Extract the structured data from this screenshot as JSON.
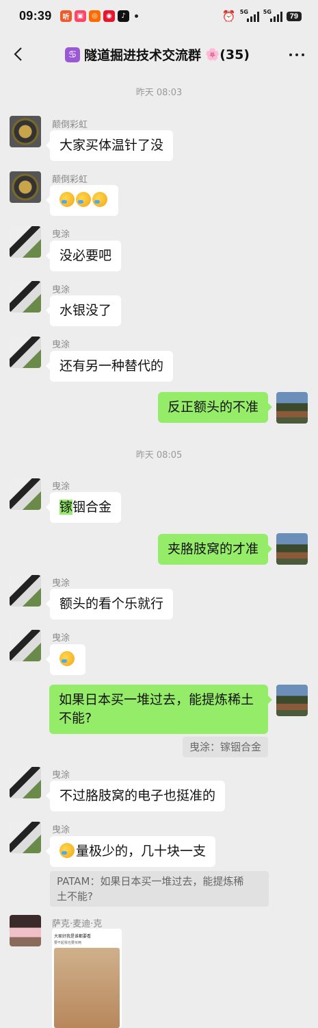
{
  "status_bar": {
    "time": "09:39",
    "apps": [
      {
        "icon": "tingshu-app-icon",
        "label": "听",
        "color": "#f05a28"
      },
      {
        "icon": "shop-app-icon",
        "label": "▣",
        "color": "#ff4466"
      },
      {
        "icon": "taobao-app-icon",
        "label": "◎",
        "color": "#ff6a00"
      },
      {
        "icon": "weibo-app-icon",
        "label": "◉",
        "color": "#e6162d"
      },
      {
        "icon": "tiktok-app-icon",
        "label": "♪",
        "color": "#111111"
      }
    ],
    "signal_label": "5G",
    "battery": "79"
  },
  "header": {
    "title": "隧道掘进技术交流群",
    "member_count": "(35)",
    "group_icon": "♋",
    "flower": "🌸"
  },
  "timestamps": [
    "昨天 08:03",
    "昨天 08:05"
  ],
  "messages": [
    {
      "sender": "颠倒彩虹",
      "text": "大家买体温针了没"
    },
    {
      "sender": "颠倒彩虹"
    },
    {
      "sender": "曳涂",
      "text": "没必要吧"
    },
    {
      "sender": "曳涂",
      "text": "水银没了"
    },
    {
      "sender": "曳涂",
      "text": "还有另一种替代的"
    },
    {
      "text": "反正额头的不准"
    },
    {
      "sender": "曳涂",
      "text_highlight": "镓",
      "text": "铟合金"
    },
    {
      "text": "夹胳肢窝的才准"
    },
    {
      "sender": "曳涂",
      "text": "额头的看个乐就行"
    },
    {
      "sender": "曳涂"
    },
    {
      "text_line1": "如果日本买一堆过去，能提炼稀土",
      "text_line2": "不能?",
      "quote": "曳涂：镓铟合金"
    },
    {
      "sender": "曳涂",
      "text": "不过胳肢窝的电子也挺准的"
    },
    {
      "sender": "曳涂",
      "text": "量极少的，几十块一支",
      "quote_line1": "PATAM：如果日本买一堆过去，能提炼稀",
      "quote_line2": "土不能?"
    },
    {
      "sender": "萨克·麦迪·克",
      "image_caption": "大家好我是谁都要看",
      "image_subcaption": "要不起我也要买两"
    }
  ],
  "colors": {
    "background": "#ededed",
    "bubble_self": "#95ec69",
    "bubble_other": "#ffffff"
  }
}
